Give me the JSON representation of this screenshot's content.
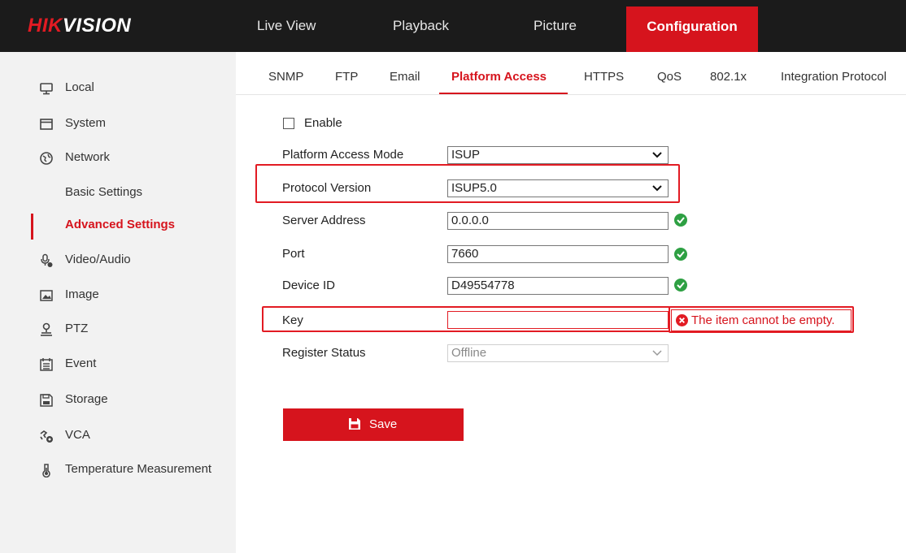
{
  "brand": {
    "logo_red": "HIK",
    "logo_white": "VISION",
    "accent_color": "#d6141d"
  },
  "topnav": {
    "items": [
      {
        "label": "Live View"
      },
      {
        "label": "Playback"
      },
      {
        "label": "Picture"
      },
      {
        "label": "Configuration",
        "active": true
      }
    ]
  },
  "sidebar": {
    "items": [
      {
        "label": "Local",
        "icon": "monitor-icon"
      },
      {
        "label": "System",
        "icon": "window-icon"
      },
      {
        "label": "Network",
        "icon": "globe-icon"
      },
      {
        "label": "Video/Audio",
        "icon": "microphone-icon"
      },
      {
        "label": "Image",
        "icon": "picture-icon"
      },
      {
        "label": "PTZ",
        "icon": "ptz-camera-icon"
      },
      {
        "label": "Event",
        "icon": "calendar-icon"
      },
      {
        "label": "Storage",
        "icon": "storage-icon"
      },
      {
        "label": "VCA",
        "icon": "vca-icon"
      },
      {
        "label": "Temperature Measurement",
        "icon": "thermometer-icon"
      }
    ],
    "network_sub": [
      {
        "label": "Basic Settings"
      },
      {
        "label": "Advanced Settings",
        "active": true
      }
    ]
  },
  "tabs": [
    {
      "label": "SNMP"
    },
    {
      "label": "FTP"
    },
    {
      "label": "Email"
    },
    {
      "label": "Platform Access",
      "active": true
    },
    {
      "label": "HTTPS"
    },
    {
      "label": "QoS"
    },
    {
      "label": "802.1x"
    },
    {
      "label": "Integration Protocol"
    }
  ],
  "form": {
    "enable": {
      "label": "Enable",
      "checked": false
    },
    "platform_access_mode": {
      "label": "Platform Access Mode",
      "value": "ISUP"
    },
    "protocol_version": {
      "label": "Protocol Version",
      "value": "ISUP5.0"
    },
    "server_address": {
      "label": "Server Address",
      "value": "0.0.0.0"
    },
    "port": {
      "label": "Port",
      "value": "7660"
    },
    "device_id": {
      "label": "Device ID",
      "value": "D49554778"
    },
    "key": {
      "label": "Key",
      "value": "",
      "error": "The item cannot be empty."
    },
    "register_status": {
      "label": "Register Status",
      "value": "Offline"
    }
  },
  "save": {
    "label": "Save"
  }
}
